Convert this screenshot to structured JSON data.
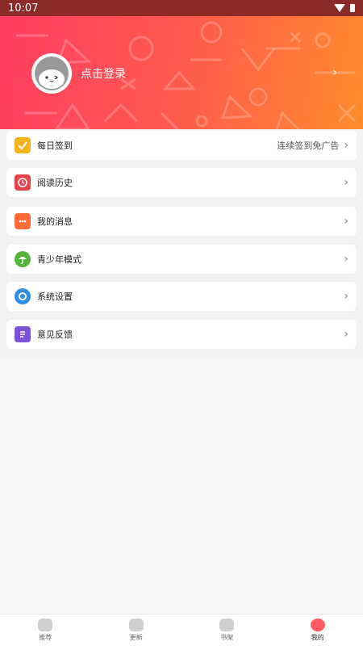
{
  "status_bar": {
    "time": "10:07"
  },
  "header": {
    "login_text": "点击登录",
    "arrow": "›"
  },
  "menu": [
    {
      "label": "每日签到",
      "extra": "连续签到免广告",
      "icon": "calendar-check-icon",
      "color": "#f5b41e"
    },
    {
      "label": "阅读历史",
      "extra": "",
      "icon": "history-clock-icon",
      "color": "#e8434c"
    },
    {
      "label": "我的消息",
      "extra": "",
      "icon": "message-icon",
      "color": "#ff6a36"
    },
    {
      "label": "青少年模式",
      "extra": "",
      "icon": "umbrella-icon",
      "color": "#57b43a"
    },
    {
      "label": "系统设置",
      "extra": "",
      "icon": "settings-icon",
      "color": "#2d8fe6"
    },
    {
      "label": "意见反馈",
      "extra": "",
      "icon": "feedback-icon",
      "color": "#7b52d8"
    }
  ],
  "chevron": "›",
  "tabbar": [
    {
      "label": "推荐",
      "icon": "recommend-icon",
      "active": false
    },
    {
      "label": "更新",
      "icon": "update-icon",
      "active": false
    },
    {
      "label": "书架",
      "icon": "bookshelf-icon",
      "active": false
    },
    {
      "label": "我的",
      "icon": "profile-icon",
      "active": true
    }
  ]
}
